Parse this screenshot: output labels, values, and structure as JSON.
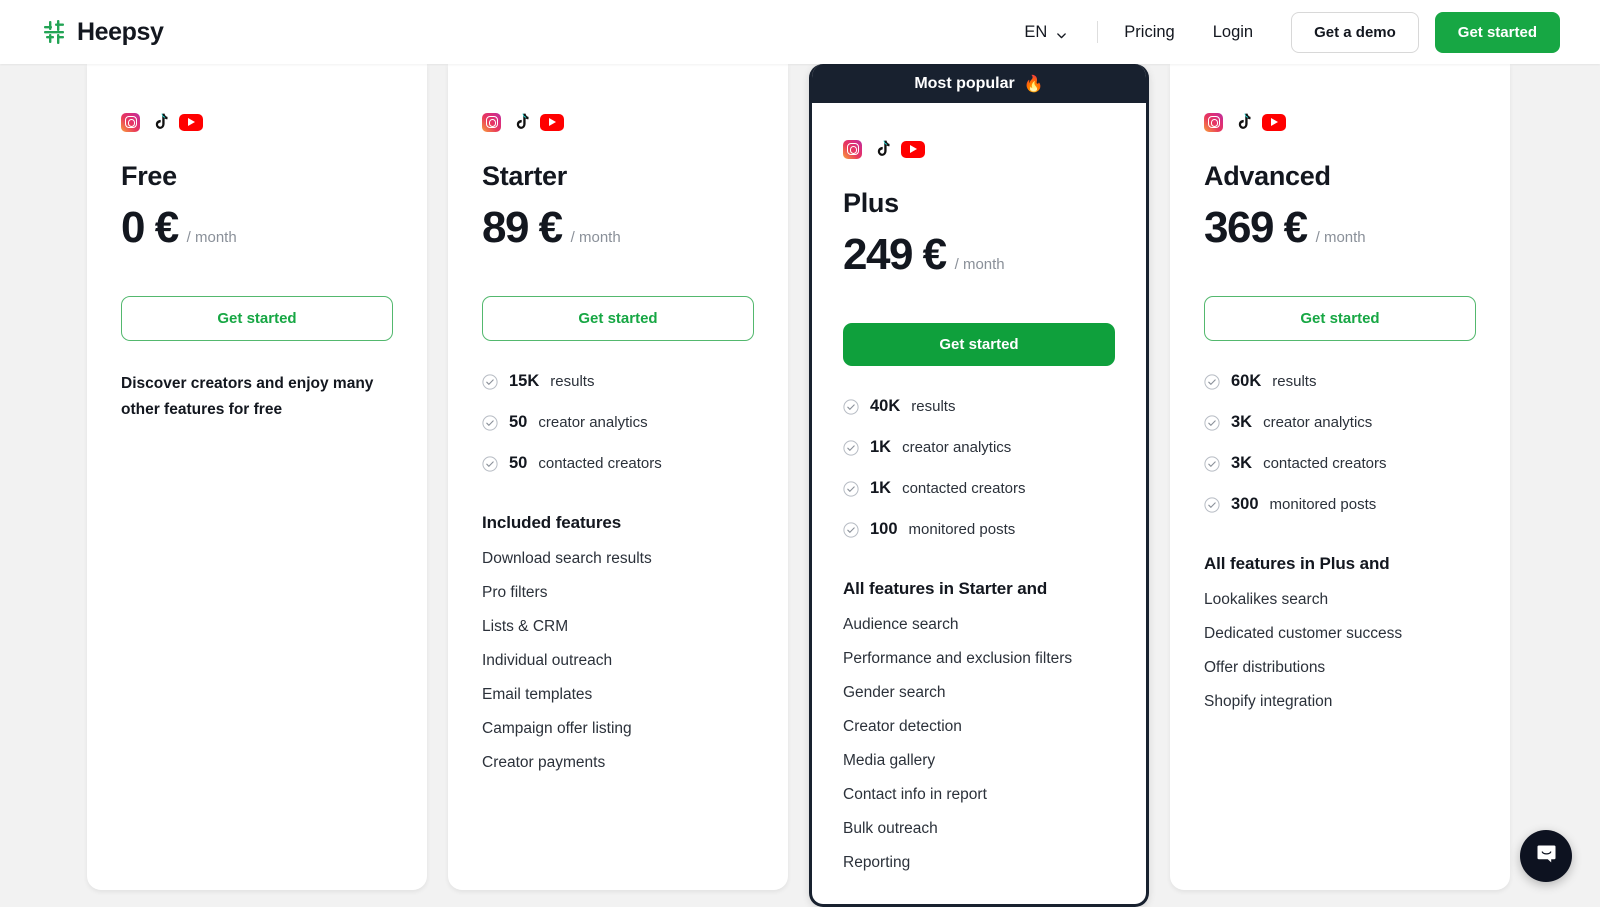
{
  "header": {
    "brand_name": "Heepsy",
    "logo_icon": "heepsy-hash-logo",
    "language": "EN",
    "chevron_icon": "chevron-down-icon",
    "links": [
      {
        "label": "Pricing",
        "name": "pricing"
      },
      {
        "label": "Login",
        "name": "login"
      }
    ],
    "demo_button": "Get a demo",
    "start_button": "Get started",
    "accent_green": "#17a744"
  },
  "popular_badge": {
    "label": "Most popular",
    "emoji": "🔥",
    "background": "#18212f"
  },
  "social_icons": [
    "instagram-icon",
    "tiktok-icon",
    "youtube-icon"
  ],
  "per_month": "/ month",
  "plans": [
    {
      "name": "Free",
      "price": "0 €",
      "cta": "Get started",
      "cta_style": "ghost",
      "popular": false,
      "blurb": "Discover creators and enjoy many other features for free",
      "quotas": [],
      "features_title": "",
      "features": []
    },
    {
      "name": "Starter",
      "price": "89 €",
      "cta": "Get started",
      "cta_style": "ghost",
      "popular": false,
      "blurb": "",
      "quotas": [
        {
          "value": "15K",
          "label": "results"
        },
        {
          "value": "50",
          "label": "creator analytics"
        },
        {
          "value": "50",
          "label": "contacted creators"
        }
      ],
      "features_title": "Included features",
      "features": [
        "Download search results",
        "Pro filters",
        "Lists & CRM",
        "Individual outreach",
        "Email templates",
        "Campaign offer listing",
        "Creator payments"
      ]
    },
    {
      "name": "Plus",
      "price": "249 €",
      "cta": "Get started",
      "cta_style": "solid",
      "popular": true,
      "blurb": "",
      "quotas": [
        {
          "value": "40K",
          "label": "results"
        },
        {
          "value": "1K",
          "label": "creator analytics"
        },
        {
          "value": "1K",
          "label": "contacted creators"
        },
        {
          "value": "100",
          "label": "monitored posts"
        }
      ],
      "features_title": "All features in Starter and",
      "features": [
        "Audience search",
        "Performance and exclusion filters",
        "Gender search",
        "Creator detection",
        "Media gallery",
        "Contact info in report",
        "Bulk outreach",
        "Reporting"
      ]
    },
    {
      "name": "Advanced",
      "price": "369 €",
      "cta": "Get started",
      "cta_style": "ghost",
      "popular": false,
      "blurb": "",
      "quotas": [
        {
          "value": "60K",
          "label": "results"
        },
        {
          "value": "3K",
          "label": "creator analytics"
        },
        {
          "value": "3K",
          "label": "contacted creators"
        },
        {
          "value": "300",
          "label": "monitored posts"
        }
      ],
      "features_title": "All features in Plus and",
      "features": [
        "Lookalikes search",
        "Dedicated customer success",
        "Offer distributions",
        "Shopify integration"
      ]
    }
  ],
  "chat_widget": {
    "icon": "intercom-chat-icon"
  }
}
